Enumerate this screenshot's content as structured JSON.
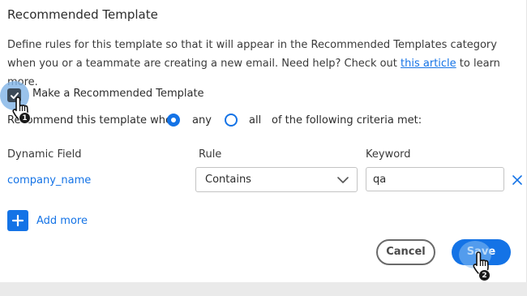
{
  "dialog": {
    "title": "Recommended Template",
    "description_before_link": "Define rules for this template so that it will appear in the Recommended Templates category when you or a teammate are creating a new email. Need help? Check out ",
    "description_link": "this article",
    "description_after_link": " to learn more."
  },
  "recommend": {
    "checkbox_label": "Make a Recommended Template",
    "checkbox_checked": true,
    "sentence_prefix": "Recommend this template when",
    "radio_any_label": "any",
    "radio_all_label": "all",
    "selected_radio": "any",
    "sentence_suffix": "of the following criteria met:"
  },
  "criteria": {
    "headers": {
      "field": "Dynamic Field",
      "rule": "Rule",
      "keyword": "Keyword"
    },
    "rows": [
      {
        "field": "company_name",
        "rule": "Contains",
        "keyword": "qa"
      }
    ],
    "add_more_label": "Add more"
  },
  "actions": {
    "cancel_label": "Cancel",
    "save_label": "Save"
  },
  "annotations": {
    "step_1": "1",
    "step_2": "2"
  },
  "colors": {
    "accent": "#1473e6",
    "checkbox": "#3c4a57"
  },
  "icons": {
    "checkbox": "checkmark-icon",
    "select": "chevron-down-icon",
    "remove": "close-icon",
    "add": "plus-icon",
    "cursor": "hand-pointer-icon"
  }
}
